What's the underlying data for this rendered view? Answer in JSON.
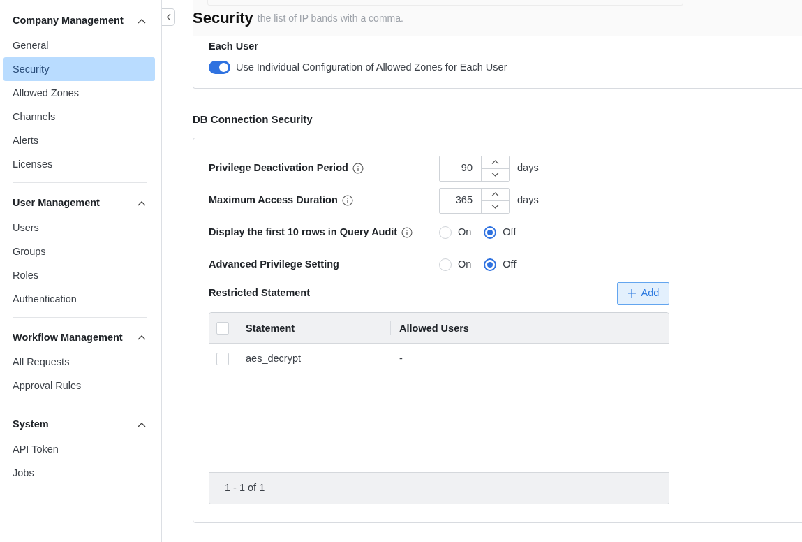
{
  "sidebar": {
    "sections": [
      {
        "title": "Company Management",
        "expanded": true,
        "items": [
          {
            "label": "General",
            "selected": false
          },
          {
            "label": "Security",
            "selected": true
          },
          {
            "label": "Allowed Zones",
            "selected": false
          },
          {
            "label": "Channels",
            "selected": false
          },
          {
            "label": "Alerts",
            "selected": false
          },
          {
            "label": "Licenses",
            "selected": false
          }
        ]
      },
      {
        "title": "User Management",
        "expanded": true,
        "items": [
          {
            "label": "Users",
            "selected": false
          },
          {
            "label": "Groups",
            "selected": false
          },
          {
            "label": "Roles",
            "selected": false
          },
          {
            "label": "Authentication",
            "selected": false
          }
        ]
      },
      {
        "title": "Workflow Management",
        "expanded": true,
        "items": [
          {
            "label": "All Requests",
            "selected": false
          },
          {
            "label": "Approval Rules",
            "selected": false
          }
        ]
      },
      {
        "title": "System",
        "expanded": true,
        "items": [
          {
            "label": "API Token",
            "selected": false
          },
          {
            "label": "Jobs",
            "selected": false
          }
        ]
      }
    ]
  },
  "page_title": "Security",
  "previous_card": {
    "hint": "the list of IP bands with a comma.",
    "each_user": {
      "label": "Each User",
      "toggle_label": "Use Individual Configuration of Allowed Zones for Each User",
      "on": true
    }
  },
  "db_section": {
    "title": "DB Connection Security",
    "settings": [
      {
        "kind": "number",
        "label": "Privilege Deactivation Period",
        "info": true,
        "value": "90",
        "unit": "days"
      },
      {
        "kind": "number",
        "label": "Maximum Access Duration",
        "info": true,
        "value": "365",
        "unit": "days"
      },
      {
        "kind": "radio",
        "label": "Display the first 10 rows in Query Audit",
        "info": true,
        "options": [
          {
            "label": "On",
            "selected": false
          },
          {
            "label": "Off",
            "selected": true
          }
        ]
      },
      {
        "kind": "radio",
        "label": "Advanced Privilege Setting",
        "info": false,
        "options": [
          {
            "label": "On",
            "selected": false
          },
          {
            "label": "Off",
            "selected": true
          }
        ]
      }
    ],
    "restricted": {
      "label": "Restricted Statement",
      "add_button": "Add",
      "table": {
        "header_checked": false,
        "columns": [
          "Statement",
          "Allowed Users"
        ],
        "rows": [
          {
            "checked": false,
            "cells": [
              "aes_decrypt",
              "-"
            ]
          }
        ],
        "footer": "1 - 1 of 1"
      }
    }
  }
}
